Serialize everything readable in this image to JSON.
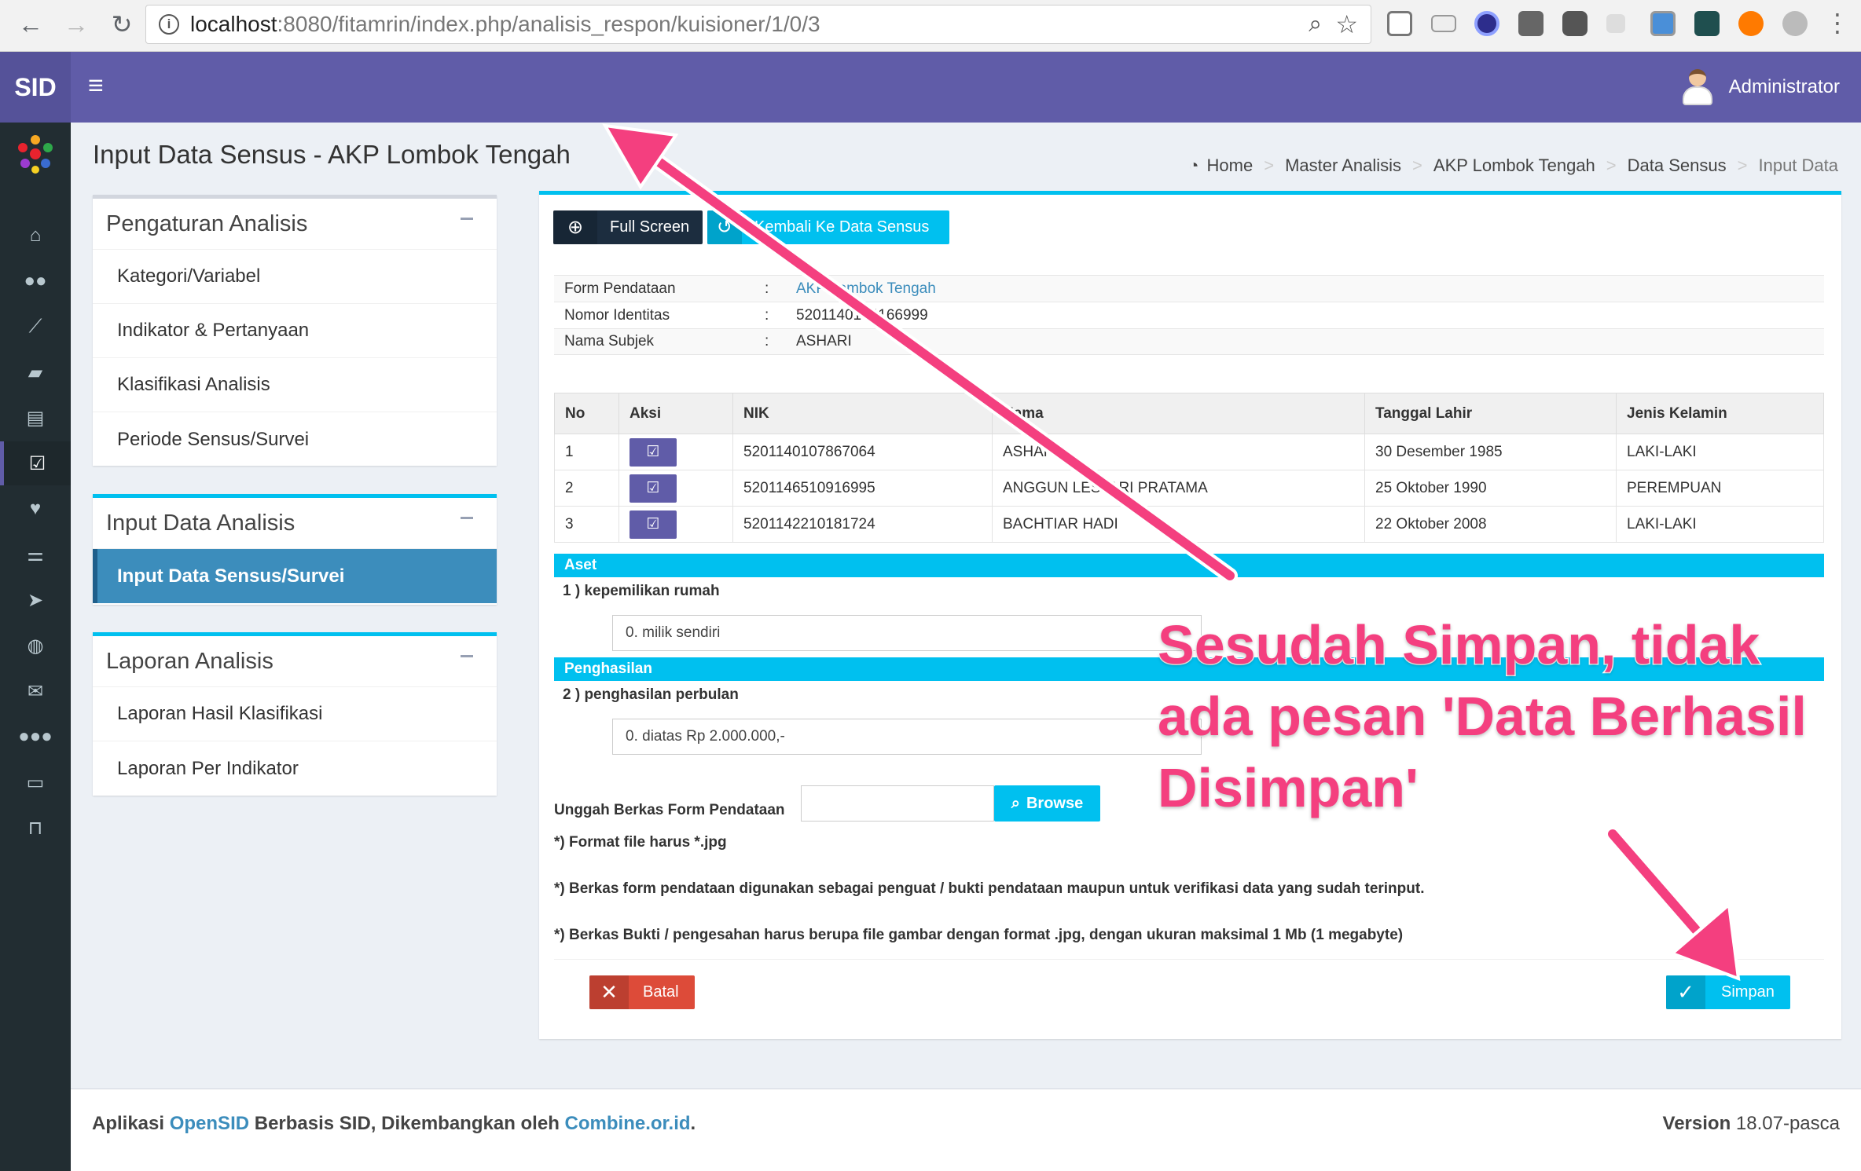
{
  "browser": {
    "url_host": "localhost",
    "url_path": ":8080/fitamrin/index.php/analisis_respon/kuisioner/1/0/3",
    "back_icon": "arrow-left-icon",
    "forward_icon": "arrow-right-icon",
    "reload_icon": "reload-icon",
    "zoom_icon": "zoom-icon",
    "star_icon": "star-icon"
  },
  "header": {
    "logo": "SID",
    "menu_icon": "hamburger-icon",
    "user_name": "Administrator",
    "brand_color": "#605ca8"
  },
  "page": {
    "title": "Input Data Sensus - AKP Lombok Tengah",
    "breadcrumb": [
      "Home",
      "Master Analisis",
      "AKP Lombok Tengah",
      "Data Sensus",
      "Input Data"
    ]
  },
  "sidebar_icons": [
    "home-icon",
    "users-icon",
    "chart-icon",
    "book-icon",
    "archive-icon",
    "check-square-icon",
    "heart-icon",
    "sliders-icon",
    "location-arrow-icon",
    "globe-icon",
    "envelope-icon",
    "group-icon",
    "desktop-icon",
    "inbox-icon"
  ],
  "panels": {
    "pengaturan": {
      "title": "Pengaturan Analisis",
      "items": [
        "Kategori/Variabel",
        "Indikator & Pertanyaan",
        "Klasifikasi Analisis",
        "Periode Sensus/Survei"
      ]
    },
    "input": {
      "title": "Input Data Analisis",
      "items": [
        "Input Data Sensus/Survei"
      ]
    },
    "laporan": {
      "title": "Laporan Analisis",
      "items": [
        "Laporan Hasil Klasifikasi",
        "Laporan Per Indikator"
      ]
    }
  },
  "toolbar": {
    "fullscreen": "Full Screen",
    "back": "Kembali Ke Data Sensus"
  },
  "info": [
    {
      "label": "Form Pendataan",
      "colon": ":",
      "value": "AKP Lombok Tengah"
    },
    {
      "label": "Nomor Identitas",
      "colon": ":",
      "value": "5201140104166999"
    },
    {
      "label": "Nama Subjek",
      "colon": ":",
      "value": "ASHARI"
    }
  ],
  "table": {
    "headers": [
      "No",
      "Aksi",
      "NIK",
      "Nama",
      "Tanggal Lahir",
      "Jenis Kelamin"
    ],
    "rows": [
      {
        "no": "1",
        "nik": "5201140107867064",
        "nama": "ASHARI",
        "tgl": "30 Desember 1985",
        "jk": "LAKI-LAKI"
      },
      {
        "no": "2",
        "nik": "5201146510916995",
        "nama": "ANGGUN LESTARI PRATAMA",
        "tgl": "25 Oktober 1990",
        "jk": "PEREMPUAN"
      },
      {
        "no": "3",
        "nik": "5201142210181724",
        "nama": "BACHTIAR HADI",
        "tgl": "22 Oktober 2008",
        "jk": "LAKI-LAKI"
      }
    ]
  },
  "form": {
    "sections": [
      {
        "title": "Aset",
        "question": "1 ) kepemilikan rumah",
        "answer": "0. milik sendiri"
      },
      {
        "title": "Penghasilan",
        "question": "2 ) penghasilan perbulan",
        "answer": "0. diatas Rp 2.000.000,-"
      }
    ],
    "upload_label": "Unggah Berkas Form Pendataan",
    "browse": "Browse",
    "notes": [
      "*) Format file harus *.jpg",
      "*) Berkas form pendataan digunakan sebagai penguat / bukti pendataan maupun untuk verifikasi data yang sudah terinput.",
      "*) Berkas Bukti / pengesahan harus berupa file gambar dengan format .jpg, dengan ukuran maksimal 1 Mb (1 megabyte)"
    ],
    "cancel": "Batal",
    "save": "Simpan"
  },
  "annotation": {
    "lines": [
      "Sesudah Simpan, tidak",
      "ada pesan 'Data Berhasil",
      "Disimpan'"
    ],
    "color": "#f43f7f"
  },
  "footer": {
    "prefix": "Aplikasi ",
    "brand": "OpenSID",
    "middle": " Berbasis SID, Dikembangkan oleh ",
    "org": "Combine.or.id",
    "suffix": ".",
    "version_label": "Version",
    "version": "18.07-pasca"
  }
}
